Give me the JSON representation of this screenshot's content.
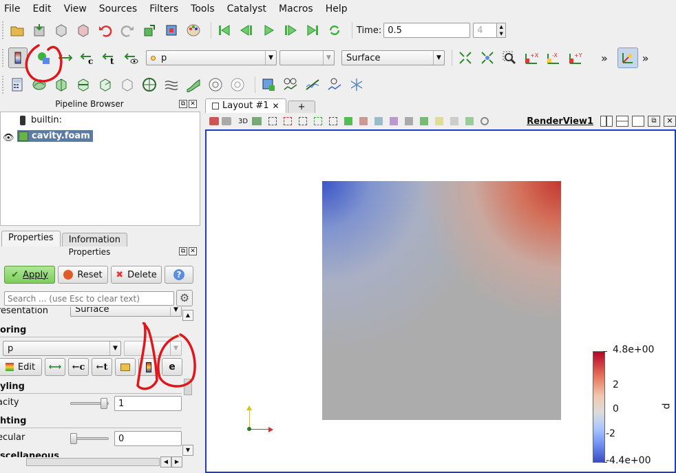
{
  "menu": [
    "File",
    "Edit",
    "View",
    "Sources",
    "Filters",
    "Tools",
    "Catalyst",
    "Macros",
    "Help"
  ],
  "time": {
    "label": "Time:",
    "value": "0.5",
    "step": "4"
  },
  "color_by": {
    "value": "p"
  },
  "representation": {
    "value": "Surface"
  },
  "more_label": "»",
  "pipeline": {
    "title": "Pipeline Browser",
    "items": [
      {
        "label": "builtin:"
      },
      {
        "label": "cavity.foam"
      }
    ]
  },
  "prop_tabs": [
    "Properties",
    "Information"
  ],
  "properties": {
    "title": "Properties",
    "apply": "Apply",
    "reset": "Reset",
    "delete": "Delete",
    "help": "?",
    "search_placeholder": "Search ... (use Esc to clear text)",
    "representation_label": "resentation",
    "representation_value": "Surface",
    "coloring_section": "oring",
    "coloring_value": "p",
    "edit": "Edit",
    "styling_section": "yling",
    "opacity_label": "acity",
    "opacity_value": "1",
    "opacity_level": 0.93,
    "lighting_section": "hting",
    "specular_label": "ecular",
    "specular_value": "0",
    "specular_level": 0.0,
    "misc_section": "scellaneous"
  },
  "layout": {
    "tab": "Layout #1",
    "add": "+",
    "view_name": "RenderView1",
    "mode_3d": "3D"
  },
  "colorbar": {
    "title": "p",
    "max": "4.8e+00",
    "t2": "2",
    "t0": "0",
    "tm2": "-2",
    "min": "-4.4e+00"
  },
  "colors": {
    "accent": "#1a3cc9",
    "annotation": "#e0161b",
    "apply_green": "#8fd66b"
  }
}
